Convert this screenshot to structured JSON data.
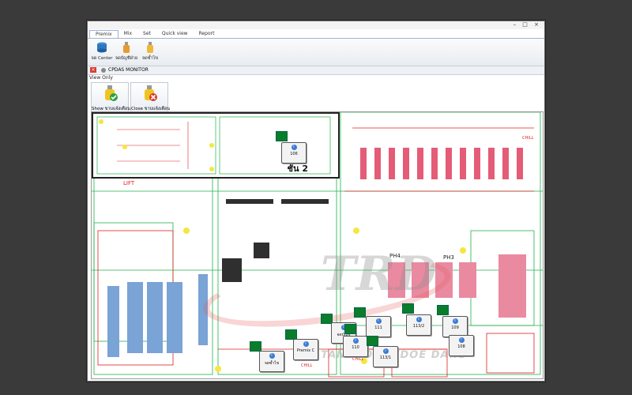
{
  "window": {
    "controls": "– □ ×"
  },
  "ribbon": {
    "tabs": [
      "Premix",
      "Mix",
      "Set",
      "Quick view",
      "Report"
    ],
    "buttons": [
      {
        "label": "จด Center",
        "icon": "db-icon"
      },
      {
        "label": "จดบัญชีฝ่าย",
        "icon": "bottle-icon"
      },
      {
        "label": "จดซ้ำไข",
        "icon": "bottle-icon"
      }
    ]
  },
  "subwindow": {
    "title": "CPDAS MONITOR",
    "view_only": "View Only"
  },
  "toolbar": {
    "show_label": "Show ขาบแจ้งเตือน",
    "close_label": "Close ขาบแจ้งเตือน"
  },
  "map": {
    "inset_label": "ชั้น 2",
    "watermark": "TANKAOMEYDOE DANE",
    "watermark_big": "TRD",
    "labels": [
      "LIFT",
      "PH4",
      "PH3",
      "CHILL",
      "CHILL",
      "CHILL"
    ],
    "bubbles": [
      {
        "text": "106"
      },
      {
        "text": "จดซ้ำไข"
      },
      {
        "text": "Premix C"
      },
      {
        "text": "จดบัญชี"
      },
      {
        "text": "110"
      },
      {
        "text": "111"
      },
      {
        "text": "113/1"
      },
      {
        "text": "113/2"
      },
      {
        "text": "109"
      },
      {
        "text": "108"
      }
    ]
  },
  "colors": {
    "accent": "#0a7d2b",
    "alarm": "#d93c2e"
  }
}
